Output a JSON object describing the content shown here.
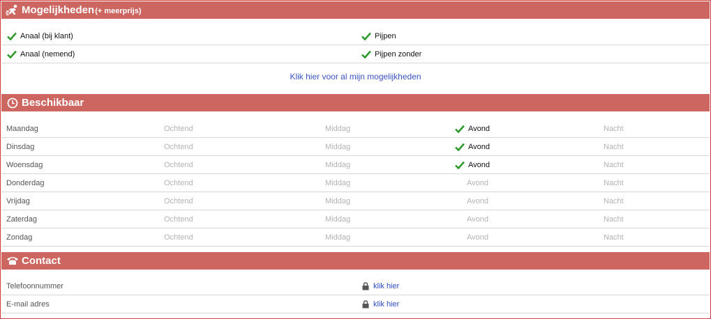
{
  "mogelijkheden": {
    "title": "Mogelijkheden",
    "subtitle": "(+ meerprijs)",
    "icon": "runner-icon",
    "items": [
      {
        "left": "Anaal (bij klant)",
        "right": "Pijpen"
      },
      {
        "left": "Anaal (nemend)",
        "right": "Pijpen zonder"
      }
    ],
    "link_label": "Klik hier voor al mijn mogelijkheden"
  },
  "beschikbaar": {
    "title": "Beschikbaar",
    "icon": "clock-icon",
    "days": [
      {
        "day": "Maandag",
        "ochtend": "Ochtend",
        "middag": "Middag",
        "avond": "Avond",
        "nacht": "Nacht",
        "avond_available": true
      },
      {
        "day": "Dinsdag",
        "ochtend": "Ochtend",
        "middag": "Middag",
        "avond": "Avond",
        "nacht": "Nacht",
        "avond_available": true
      },
      {
        "day": "Woensdag",
        "ochtend": "Ochtend",
        "middag": "Middag",
        "avond": "Avond",
        "nacht": "Nacht",
        "avond_available": true
      },
      {
        "day": "Donderdag",
        "ochtend": "Ochtend",
        "middag": "Middag",
        "avond": "Avond",
        "nacht": "Nacht",
        "avond_available": false
      },
      {
        "day": "Vrijdag",
        "ochtend": "Ochtend",
        "middag": "Middag",
        "avond": "Avond",
        "nacht": "Nacht",
        "avond_available": false
      },
      {
        "day": "Zaterdag",
        "ochtend": "Ochtend",
        "middag": "Middag",
        "avond": "Avond",
        "nacht": "Nacht",
        "avond_available": false
      },
      {
        "day": "Zondag",
        "ochtend": "Ochtend",
        "middag": "Middag",
        "avond": "Avond",
        "nacht": "Nacht",
        "avond_available": false
      }
    ]
  },
  "contact": {
    "title": "Contact",
    "icon": "telephone-icon",
    "items": [
      {
        "label": "Telefoonnummer",
        "link": "klik hier"
      },
      {
        "label": "E-mail adres",
        "link": "klik hier"
      }
    ]
  },
  "colors": {
    "header_bg": "#cd6660",
    "check_green": "#2e9a2e",
    "link_blue": "#2c4bbf",
    "frame_border": "#d23b3b"
  }
}
